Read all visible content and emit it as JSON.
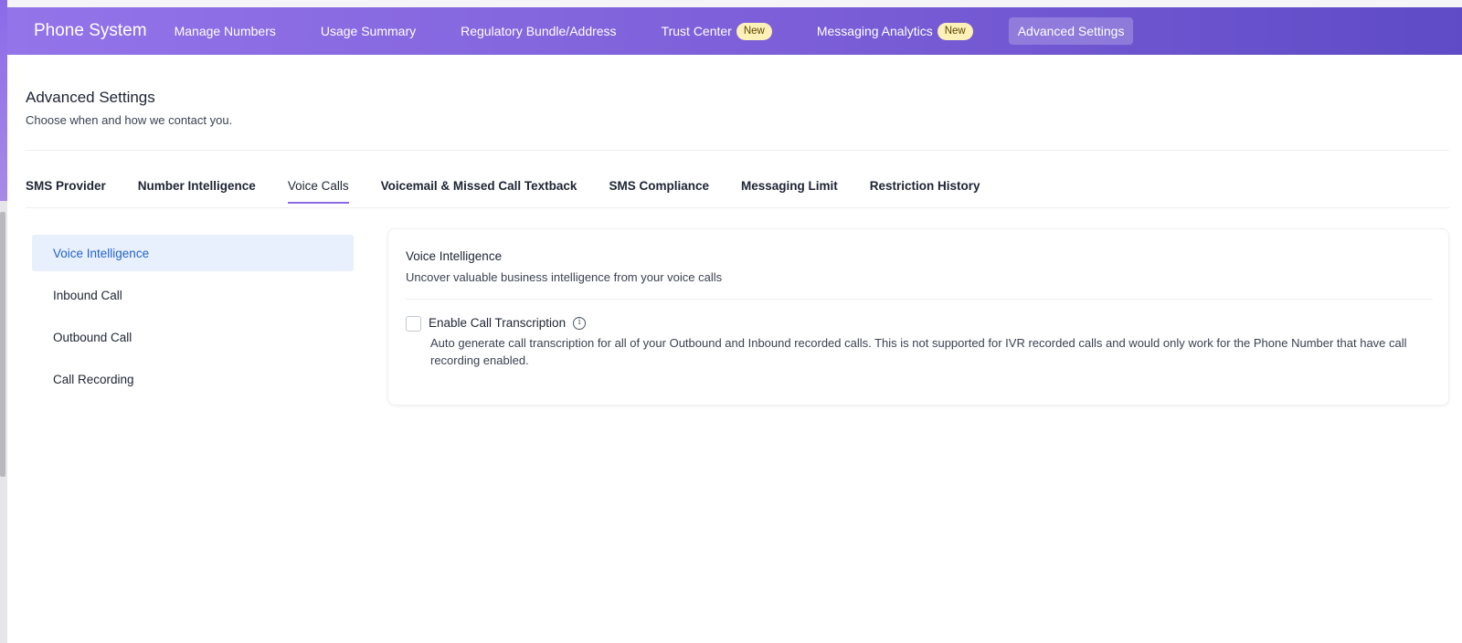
{
  "header": {
    "brand": "Phone System",
    "nav": [
      {
        "label": "Manage Numbers",
        "badge": ""
      },
      {
        "label": "Usage Summary",
        "badge": ""
      },
      {
        "label": "Regulatory Bundle/Address",
        "badge": ""
      },
      {
        "label": "Trust Center",
        "badge": "New"
      },
      {
        "label": "Messaging Analytics",
        "badge": "New"
      },
      {
        "label": "Advanced Settings",
        "badge": "",
        "active": true
      }
    ]
  },
  "page": {
    "title": "Advanced Settings",
    "subtitle": "Choose when and how we contact you."
  },
  "tabs": [
    {
      "label": "SMS Provider"
    },
    {
      "label": "Number Intelligence"
    },
    {
      "label": "Voice Calls",
      "active": true
    },
    {
      "label": "Voicemail & Missed Call Textback"
    },
    {
      "label": "SMS Compliance"
    },
    {
      "label": "Messaging Limit"
    },
    {
      "label": "Restriction History"
    }
  ],
  "side_menu": [
    {
      "label": "Voice Intelligence",
      "active": true
    },
    {
      "label": "Inbound Call"
    },
    {
      "label": "Outbound Call"
    },
    {
      "label": "Call Recording"
    }
  ],
  "card": {
    "title": "Voice Intelligence",
    "subtitle": "Uncover valuable business intelligence from your voice calls",
    "option_label": "Enable Call Transcription",
    "option_checked": false,
    "option_description": "Auto generate call transcription for all of your Outbound and Inbound recorded calls. This is not supported for IVR recorded calls and would only work for the Phone Number that have call recording enabled.",
    "info_glyph": "i"
  },
  "colors": {
    "header_start": "#9474e9",
    "header_end": "#5f4bc6",
    "active_side_bg": "#e8f0fd",
    "active_side_text": "#2563c9",
    "badge_bg": "#fdf1b8",
    "tab_underline": "#8b6ae8"
  }
}
